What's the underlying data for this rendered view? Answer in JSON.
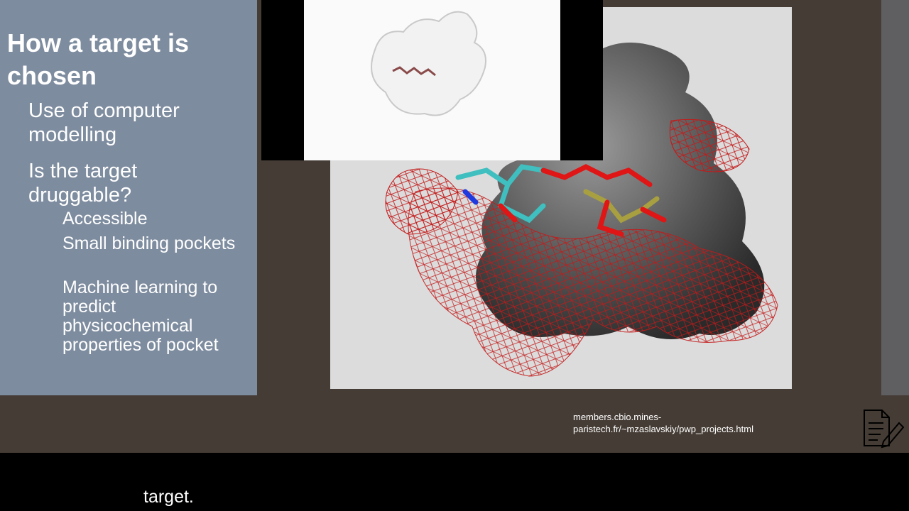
{
  "slide": {
    "title": "How a target is chosen",
    "bullets": [
      {
        "text": "Use of computer modelling"
      },
      {
        "text": "Is the target druggable?",
        "sub": [
          {
            "text": "Accessible"
          },
          {
            "text": "Small binding pockets"
          },
          {
            "text": "Machine learning to predict physicochemical properties of pocket"
          }
        ]
      }
    ],
    "source_url": "members.cbio.mines-paristech.fr/~mzaslavskiy/pwp_projects.html"
  },
  "icons": {
    "notes": "notes-edit-icon"
  },
  "subtitle": {
    "text": "target."
  },
  "colors": {
    "slide_background": "#453c35",
    "left_panel": "#7e8c9f",
    "mesh": "#c41a1a",
    "ligand_carbon": "#3fbfbf",
    "ligand_oxygen": "#e01515",
    "phosphorus": "#a8a040"
  }
}
